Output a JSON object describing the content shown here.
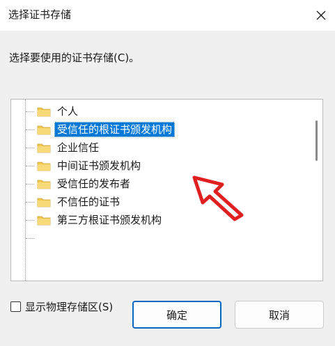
{
  "window": {
    "title": "选择证书存储"
  },
  "prompt": "选择要使用的证书存储(C)。",
  "tree": {
    "items": [
      {
        "label": "个人"
      },
      {
        "label": "受信任的根证书颁发机构"
      },
      {
        "label": "企业信任"
      },
      {
        "label": "中间证书颁发机构"
      },
      {
        "label": "受信任的发布者"
      },
      {
        "label": "不信任的证书"
      },
      {
        "label": "第三方根证书颁发机构"
      }
    ],
    "selected_index": 1
  },
  "show_physical": {
    "label": "显示物理存储区(S)",
    "checked": false
  },
  "buttons": {
    "ok": "确定",
    "cancel": "取消"
  },
  "colors": {
    "selection": "#0078d7",
    "folder": "#f2c94c",
    "annotation_arrow": "#e02020",
    "primary_border": "#0067c0"
  }
}
